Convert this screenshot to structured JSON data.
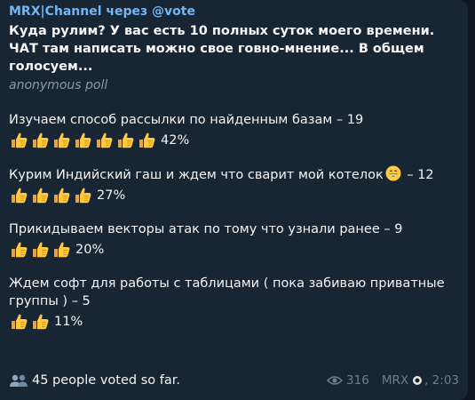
{
  "message": {
    "sender": "MRX|Channel через @vote",
    "question": "Куда рулим? У вас есть 10 полных суток моего времени. ЧАТ там написать можно свое говно-мнение... В общем голосуем...",
    "poll_type": "anonymous poll",
    "options": [
      {
        "text": "Изучаем способ рассылки по найденным базам – 19",
        "percent": "42%",
        "thumbs": 7
      },
      {
        "text": "Курим Индийский гаш и ждем что сварит мой котелок",
        "text_tail": " – 12",
        "emoji": "grinning-face",
        "percent": "27%",
        "thumbs": 4
      },
      {
        "text": "Прикидываем векторы атак по тому что узнали ранее – 9",
        "percent": "20%",
        "thumbs": 3
      },
      {
        "text": "Ждем софт для работы с таблицами ( пока забиваю приватные группы ) – 5",
        "percent": "11%",
        "thumbs": 2
      }
    ],
    "voters": "45 people voted so far.",
    "views": "316",
    "author": "MRX",
    "time": ", 2:03"
  },
  "colors": {
    "background": "#0e1621",
    "bubble": "#182533",
    "sender": "#71b6f5",
    "muted": "#6d7f8f"
  },
  "icons": [
    "thumbs-up-emoji",
    "grinning-face-emoji",
    "people-icon",
    "eye-icon",
    "dot-emoji"
  ]
}
